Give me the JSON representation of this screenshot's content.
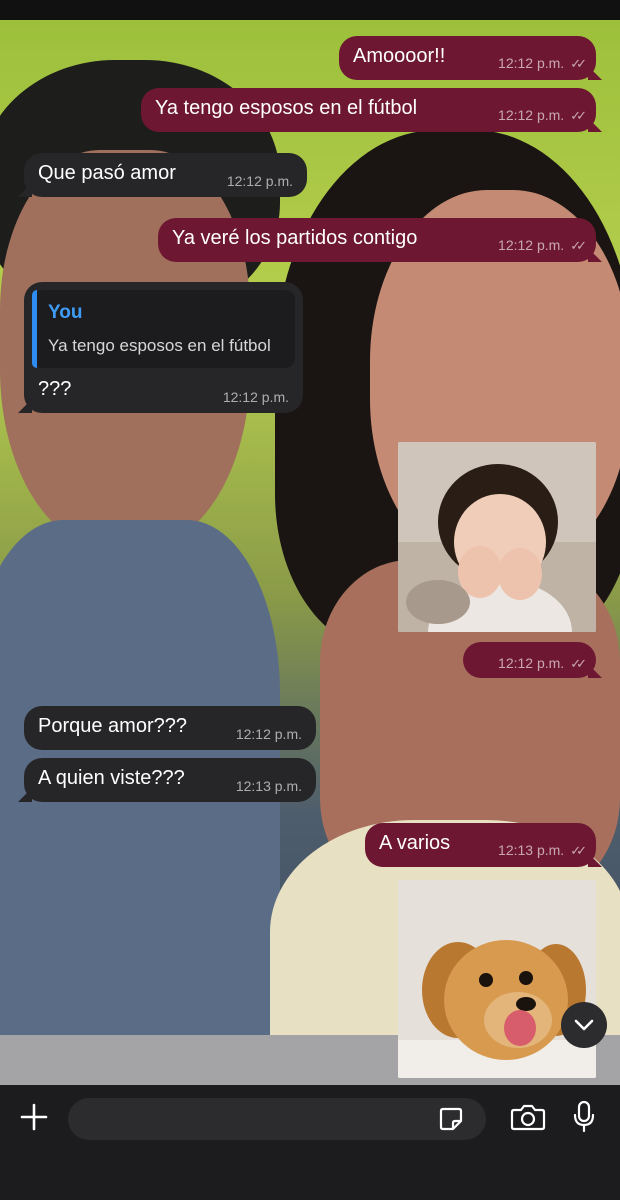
{
  "messages": [
    {
      "dir": "out",
      "text": "Amoooor!!",
      "time": "12:12 p.m."
    },
    {
      "dir": "out",
      "text": "Ya tengo esposos en el fútbol",
      "time": "12:12 p.m."
    },
    {
      "dir": "in",
      "text": "Que pasó amor",
      "time": "12:12 p.m."
    },
    {
      "dir": "out",
      "text": "Ya veré los partidos contigo",
      "time": "12:12 p.m."
    },
    {
      "dir": "in",
      "text": "???",
      "time": "12:12 p.m.",
      "reply": {
        "author": "You",
        "quote": "Ya tengo esposos en el fútbol"
      }
    },
    {
      "dir": "out",
      "sticker": "laughing-toddler",
      "time": "12:12 p.m."
    },
    {
      "dir": "in",
      "text": "Porque amor???",
      "time": "12:12 p.m."
    },
    {
      "dir": "in",
      "text": "A quien viste???",
      "time": "12:13 p.m."
    },
    {
      "dir": "out",
      "text": "A varios",
      "time": "12:13 p.m."
    },
    {
      "dir": "out",
      "sticker": "happy-puppy"
    }
  ],
  "ticks": "✓✓",
  "composer": {
    "placeholder": ""
  },
  "icons": {
    "add": "plus-icon",
    "sticker": "sticker-icon",
    "camera": "camera-icon",
    "mic": "microphone-icon",
    "scroll": "chevron-down-icon"
  },
  "colors": {
    "outgoing": "#6e1732",
    "incoming": "#262628",
    "accent": "#3e9cf6"
  }
}
